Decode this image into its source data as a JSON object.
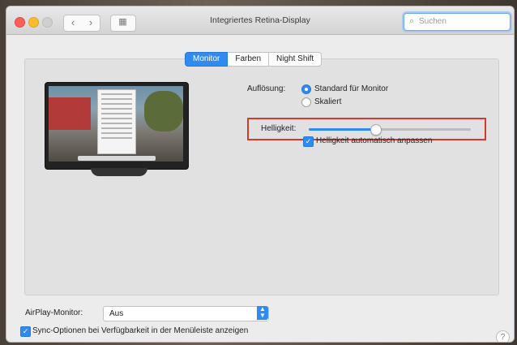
{
  "window": {
    "title": "Integriertes Retina-Display",
    "search_placeholder": "Suchen"
  },
  "tabs": [
    "Monitor",
    "Farben",
    "Night Shift"
  ],
  "active_tab": "Monitor",
  "resolution": {
    "label": "Auflösung:",
    "options": [
      "Standard für Monitor",
      "Skaliert"
    ],
    "selected": "Standard für Monitor"
  },
  "brightness": {
    "label": "Helligkeit:",
    "level_fraction": 0.41,
    "auto_label": "Helligkeit automatisch anpassen",
    "auto_checked": true
  },
  "airplay": {
    "label": "AirPlay-Monitor:",
    "value": "Aus"
  },
  "sync": {
    "label": "Sync-Optionen bei Verfügbarkeit in der Menüleiste anzeigen",
    "checked": true
  },
  "colors": {
    "accent": "#2f8bf0",
    "highlight_border": "#d23a2f"
  }
}
